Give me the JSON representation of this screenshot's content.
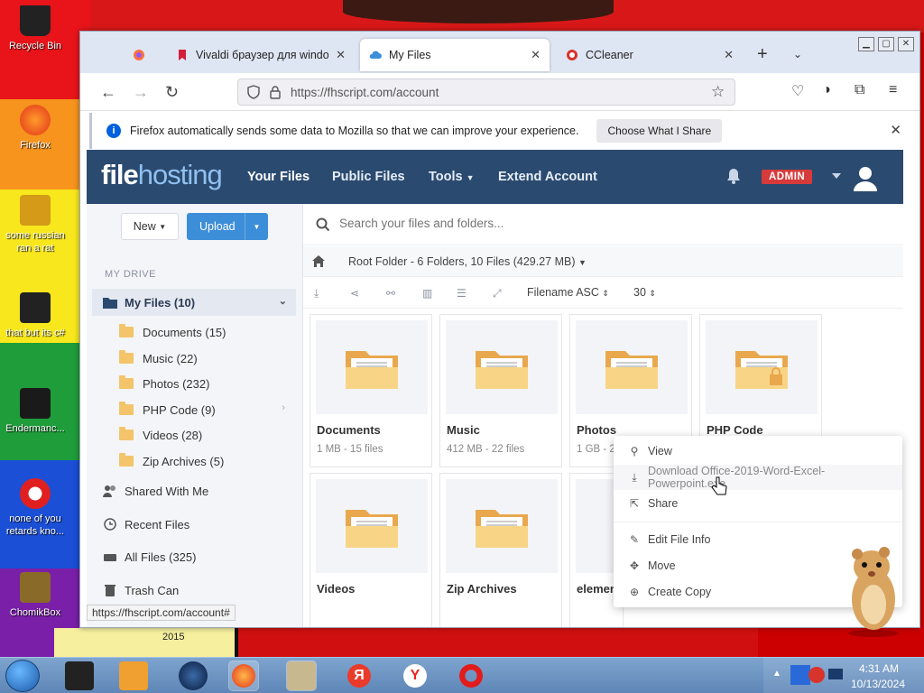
{
  "desktop": {
    "icons": [
      {
        "label": "Recycle Bin"
      },
      {
        "label": "Firefox"
      },
      {
        "label": "some russian ran a rat"
      },
      {
        "label": "that but its c#"
      },
      {
        "label": "Endermanc..."
      },
      {
        "label": "none of you retards kno..."
      },
      {
        "label": "ChomikBox"
      }
    ],
    "bottom_year": "2015"
  },
  "browser": {
    "tabs": [
      {
        "title": "Vivaldi браузер для windows",
        "active": false
      },
      {
        "title": "My Files",
        "active": true
      },
      {
        "title": "CCleaner",
        "active": false
      }
    ],
    "url": "https://fhscript.com/account",
    "notification": {
      "message": "Firefox automatically sends some data to Mozilla so that we can improve your experience.",
      "button": "Choose What I Share"
    },
    "status_link": "https://fhscript.com/account#"
  },
  "site": {
    "logo_a": "file",
    "logo_b": "hosting",
    "nav": [
      "Your Files",
      "Public Files",
      "Tools",
      "Extend Account"
    ],
    "admin_badge": "ADMIN"
  },
  "sidebar": {
    "new_label": "New",
    "upload_label": "Upload",
    "section": "MY DRIVE",
    "my_files": "My Files (10)",
    "folders": [
      "Documents (15)",
      "Music (22)",
      "Photos (232)",
      "PHP Code (9)",
      "Videos (28)",
      "Zip Archives (5)"
    ],
    "shared": "Shared With Me",
    "recent": "Recent Files",
    "all": "All Files (325)",
    "trash": "Trash Can"
  },
  "main": {
    "search_placeholder": "Search your files and folders...",
    "breadcrumb": "Root Folder - 6 Folders, 10 Files (429.27 MB)",
    "sort": "Filename ASC",
    "per_page": "30",
    "folders": [
      {
        "name": "Documents",
        "meta": "1 MB - 15 files"
      },
      {
        "name": "Music",
        "meta": "412 MB - 22 files"
      },
      {
        "name": "Photos",
        "meta": "1 GB - 2"
      },
      {
        "name": "PHP Code",
        "meta": ""
      },
      {
        "name": "Videos",
        "meta": ""
      },
      {
        "name": "Zip Archives",
        "meta": ""
      },
      {
        "name": "elemen",
        "meta": ""
      }
    ]
  },
  "context_menu": {
    "items": [
      "View",
      "Download Office-2019-Word-Excel-Powerpoint.exe",
      "Share",
      "Edit File Info",
      "Move",
      "Create Copy"
    ]
  },
  "taskbar": {
    "time": "4:31 AM",
    "date": "10/13/2024"
  }
}
